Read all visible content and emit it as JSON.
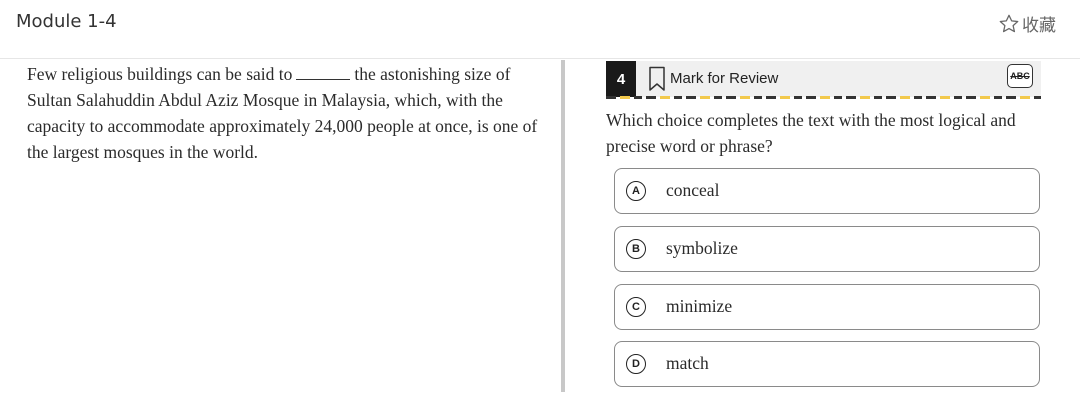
{
  "header": {
    "module_title": "Module 1-4",
    "favorite_label": "收藏",
    "favorite_icon": "star-outline-icon"
  },
  "passage": {
    "text_before_blank": "Few religious buildings can be said to",
    "text_after_blank": "the astonishing size of Sultan Salahuddin Abdul Aziz Mosque in Malaysia, which, with the capacity to accommodate approximately 24,000 people at once, is one of the largest mosques in the world."
  },
  "question_bar": {
    "number": "4",
    "mark_for_review": "Mark for Review",
    "bookmark_icon": "bookmark-icon",
    "abc_label": "ABC",
    "abc_icon": "strikethrough-abc-icon"
  },
  "question": {
    "prompt": "Which choice completes the text with the most logical and precise word or phrase?"
  },
  "choices": [
    {
      "letter": "A",
      "text": "conceal"
    },
    {
      "letter": "B",
      "text": "symbolize"
    },
    {
      "letter": "C",
      "text": "minimize"
    },
    {
      "letter": "D",
      "text": "match"
    }
  ],
  "colors": {
    "divider": "#c8c8c8",
    "question_number_bg": "#1a1a1a",
    "question_bar_bg": "#f0f0f0",
    "dash_accent": "#f2c94c"
  }
}
